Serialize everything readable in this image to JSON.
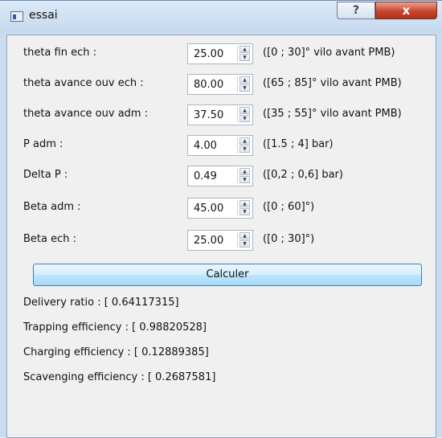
{
  "window": {
    "title": "essai",
    "help_label": "?",
    "close_label": "x"
  },
  "fields": [
    {
      "label": "theta fin ech :",
      "value": "25.00",
      "range": "([0 ; 30]° vilo avant PMB)"
    },
    {
      "label": "theta avance ouv ech :",
      "value": "80.00",
      "range": "([65 ; 85]° vilo avant PMB)"
    },
    {
      "label": "theta avance ouv adm :",
      "value": "37.50",
      "range": "([35 ; 55]° vilo avant PMB)"
    },
    {
      "label": "P adm :",
      "value": "4.00",
      "range": "([1.5 ; 4] bar)"
    },
    {
      "label": "Delta P :",
      "value": "0.49",
      "range": "([0,2 ; 0,6] bar)"
    },
    {
      "label": "Beta adm :",
      "value": "45.00",
      "range": "([0 ; 60]°)"
    },
    {
      "label": "Beta ech :",
      "value": "25.00",
      "range": "([0 ; 30]°)"
    }
  ],
  "calculate_label": "Calculer",
  "results": [
    "Delivery ratio : [ 0.64117315]",
    "Trapping efficiency : [ 0.98820528]",
    "Charging efficiency : [ 0.12889385]",
    "Scavenging efficiency : [ 0.2687581]"
  ],
  "icons": {
    "spin_up": "spin-up-arrow-icon",
    "spin_down": "spin-down-arrow-icon",
    "app": "window-app-icon"
  }
}
